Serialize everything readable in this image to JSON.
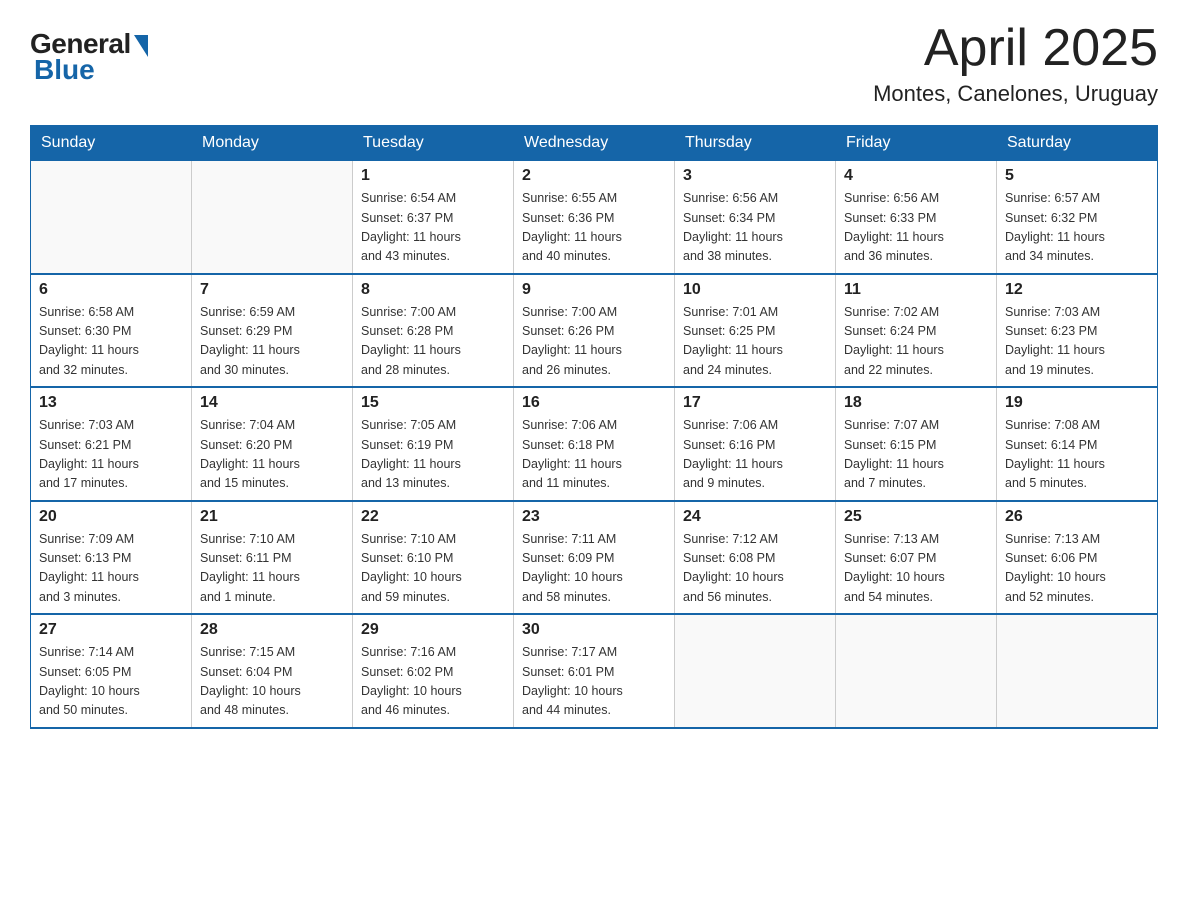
{
  "logo": {
    "general": "General",
    "blue": "Blue"
  },
  "title": "April 2025",
  "subtitle": "Montes, Canelones, Uruguay",
  "headers": [
    "Sunday",
    "Monday",
    "Tuesday",
    "Wednesday",
    "Thursday",
    "Friday",
    "Saturday"
  ],
  "weeks": [
    [
      {
        "day": "",
        "info": ""
      },
      {
        "day": "",
        "info": ""
      },
      {
        "day": "1",
        "info": "Sunrise: 6:54 AM\nSunset: 6:37 PM\nDaylight: 11 hours\nand 43 minutes."
      },
      {
        "day": "2",
        "info": "Sunrise: 6:55 AM\nSunset: 6:36 PM\nDaylight: 11 hours\nand 40 minutes."
      },
      {
        "day": "3",
        "info": "Sunrise: 6:56 AM\nSunset: 6:34 PM\nDaylight: 11 hours\nand 38 minutes."
      },
      {
        "day": "4",
        "info": "Sunrise: 6:56 AM\nSunset: 6:33 PM\nDaylight: 11 hours\nand 36 minutes."
      },
      {
        "day": "5",
        "info": "Sunrise: 6:57 AM\nSunset: 6:32 PM\nDaylight: 11 hours\nand 34 minutes."
      }
    ],
    [
      {
        "day": "6",
        "info": "Sunrise: 6:58 AM\nSunset: 6:30 PM\nDaylight: 11 hours\nand 32 minutes."
      },
      {
        "day": "7",
        "info": "Sunrise: 6:59 AM\nSunset: 6:29 PM\nDaylight: 11 hours\nand 30 minutes."
      },
      {
        "day": "8",
        "info": "Sunrise: 7:00 AM\nSunset: 6:28 PM\nDaylight: 11 hours\nand 28 minutes."
      },
      {
        "day": "9",
        "info": "Sunrise: 7:00 AM\nSunset: 6:26 PM\nDaylight: 11 hours\nand 26 minutes."
      },
      {
        "day": "10",
        "info": "Sunrise: 7:01 AM\nSunset: 6:25 PM\nDaylight: 11 hours\nand 24 minutes."
      },
      {
        "day": "11",
        "info": "Sunrise: 7:02 AM\nSunset: 6:24 PM\nDaylight: 11 hours\nand 22 minutes."
      },
      {
        "day": "12",
        "info": "Sunrise: 7:03 AM\nSunset: 6:23 PM\nDaylight: 11 hours\nand 19 minutes."
      }
    ],
    [
      {
        "day": "13",
        "info": "Sunrise: 7:03 AM\nSunset: 6:21 PM\nDaylight: 11 hours\nand 17 minutes."
      },
      {
        "day": "14",
        "info": "Sunrise: 7:04 AM\nSunset: 6:20 PM\nDaylight: 11 hours\nand 15 minutes."
      },
      {
        "day": "15",
        "info": "Sunrise: 7:05 AM\nSunset: 6:19 PM\nDaylight: 11 hours\nand 13 minutes."
      },
      {
        "day": "16",
        "info": "Sunrise: 7:06 AM\nSunset: 6:18 PM\nDaylight: 11 hours\nand 11 minutes."
      },
      {
        "day": "17",
        "info": "Sunrise: 7:06 AM\nSunset: 6:16 PM\nDaylight: 11 hours\nand 9 minutes."
      },
      {
        "day": "18",
        "info": "Sunrise: 7:07 AM\nSunset: 6:15 PM\nDaylight: 11 hours\nand 7 minutes."
      },
      {
        "day": "19",
        "info": "Sunrise: 7:08 AM\nSunset: 6:14 PM\nDaylight: 11 hours\nand 5 minutes."
      }
    ],
    [
      {
        "day": "20",
        "info": "Sunrise: 7:09 AM\nSunset: 6:13 PM\nDaylight: 11 hours\nand 3 minutes."
      },
      {
        "day": "21",
        "info": "Sunrise: 7:10 AM\nSunset: 6:11 PM\nDaylight: 11 hours\nand 1 minute."
      },
      {
        "day": "22",
        "info": "Sunrise: 7:10 AM\nSunset: 6:10 PM\nDaylight: 10 hours\nand 59 minutes."
      },
      {
        "day": "23",
        "info": "Sunrise: 7:11 AM\nSunset: 6:09 PM\nDaylight: 10 hours\nand 58 minutes."
      },
      {
        "day": "24",
        "info": "Sunrise: 7:12 AM\nSunset: 6:08 PM\nDaylight: 10 hours\nand 56 minutes."
      },
      {
        "day": "25",
        "info": "Sunrise: 7:13 AM\nSunset: 6:07 PM\nDaylight: 10 hours\nand 54 minutes."
      },
      {
        "day": "26",
        "info": "Sunrise: 7:13 AM\nSunset: 6:06 PM\nDaylight: 10 hours\nand 52 minutes."
      }
    ],
    [
      {
        "day": "27",
        "info": "Sunrise: 7:14 AM\nSunset: 6:05 PM\nDaylight: 10 hours\nand 50 minutes."
      },
      {
        "day": "28",
        "info": "Sunrise: 7:15 AM\nSunset: 6:04 PM\nDaylight: 10 hours\nand 48 minutes."
      },
      {
        "day": "29",
        "info": "Sunrise: 7:16 AM\nSunset: 6:02 PM\nDaylight: 10 hours\nand 46 minutes."
      },
      {
        "day": "30",
        "info": "Sunrise: 7:17 AM\nSunset: 6:01 PM\nDaylight: 10 hours\nand 44 minutes."
      },
      {
        "day": "",
        "info": ""
      },
      {
        "day": "",
        "info": ""
      },
      {
        "day": "",
        "info": ""
      }
    ]
  ]
}
